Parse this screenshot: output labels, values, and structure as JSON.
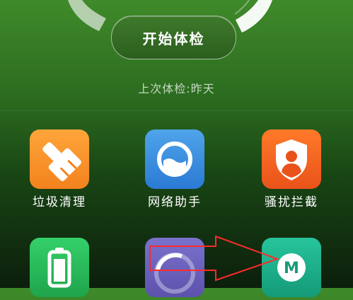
{
  "header": {
    "start_button_label": "开始体检",
    "last_check_text": "上次体检:昨天"
  },
  "tools": [
    {
      "label": "垃圾清理",
      "icon": "broom-icon",
      "color": "#f3821d"
    },
    {
      "label": "网络助手",
      "icon": "network-icon",
      "color": "#2b7ad4"
    },
    {
      "label": "骚扰拦截",
      "icon": "shield-user-icon",
      "color": "#e9521a"
    },
    {
      "label": "",
      "icon": "battery-icon",
      "color": "#1fa44c"
    },
    {
      "label": "",
      "icon": "speed-dial-icon",
      "color": "#5c52ad"
    },
    {
      "label": "",
      "icon": "m-badge-icon",
      "color": "#159a78"
    }
  ],
  "colors": {
    "annotation_arrow": "#ff2a2a"
  }
}
